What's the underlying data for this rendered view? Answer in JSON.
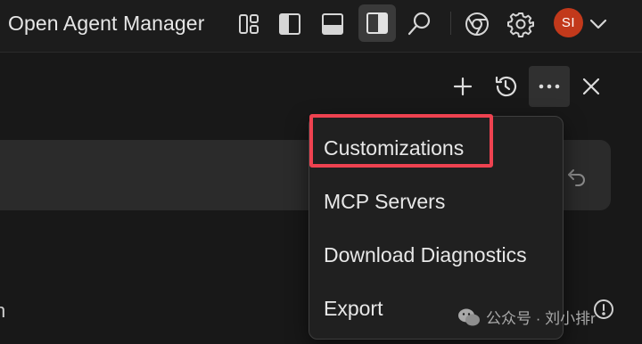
{
  "titlebar": {
    "app_title": "Open Agent Manager",
    "toolbar_icons": [
      "layout-grid-icon",
      "toggle-left-sidebar-icon",
      "toggle-bottom-panel-icon",
      "toggle-right-sidebar-icon",
      "search-icon",
      "chrome-browser-icon",
      "gear-icon"
    ],
    "active_icon": "toggle-right-sidebar-icon",
    "user": {
      "initials": "SI",
      "avatar_color": "#c2391b"
    }
  },
  "panel": {
    "actions": [
      "plus-icon",
      "history-icon",
      "more-icon",
      "close-icon"
    ],
    "active_action": "more-icon",
    "edge_text": "n"
  },
  "menu": {
    "items": [
      {
        "label": "Customizations",
        "highlighted": true
      },
      {
        "label": "MCP Servers"
      },
      {
        "label": "Download Diagnostics"
      },
      {
        "label": "Export"
      }
    ],
    "highlight_color": "#ee4250"
  },
  "watermark": {
    "text": "公众号 · 刘小排r"
  },
  "colors": {
    "background": "#181818",
    "titlebar": "#1c1c1c",
    "menu_background": "#202020",
    "input_background": "#2b2b2b",
    "highlight": "#ee4250"
  }
}
